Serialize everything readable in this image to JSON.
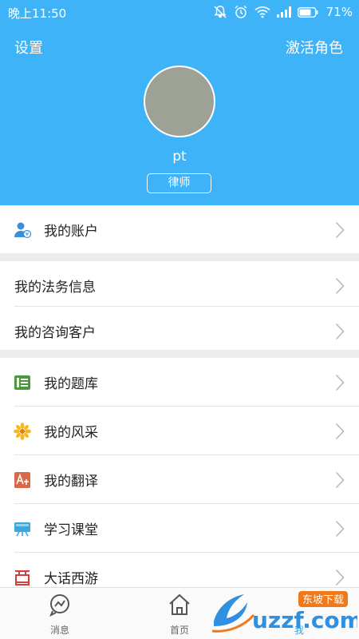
{
  "status": {
    "time": "晚上11:50",
    "battery": "71%"
  },
  "header": {
    "settings_label": "设置",
    "activate_label": "激活角色",
    "username": "pt",
    "role": "律师"
  },
  "menu": {
    "account": "我的账户",
    "legal_info": "我的法务信息",
    "consult_clients": "我的咨询客户",
    "question_bank": "我的题库",
    "style": "我的风采",
    "translate": "我的翻译",
    "classroom": "学习课堂",
    "journey_west": "大话西游",
    "icons": {
      "account": "account-icon",
      "question_bank": "question-bank-icon",
      "style": "flower-icon",
      "translate": "translate-icon",
      "classroom": "classroom-icon",
      "journey_west": "xi-character-icon"
    }
  },
  "tabs": {
    "messages": "消息",
    "home": "首页",
    "me": "我"
  },
  "watermark": {
    "brand": "uzzf.com",
    "sub": "东坡下载"
  },
  "colors": {
    "header_bg": "#3eb3f7",
    "active_tab": "#3aa0e6"
  }
}
